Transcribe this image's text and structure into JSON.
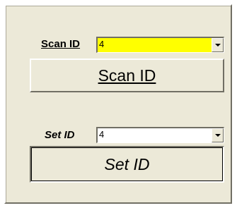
{
  "scan": {
    "label": "Scan ID",
    "value": "4",
    "button_label": "Scan ID",
    "field_color": "#ffff00"
  },
  "set": {
    "label": "Set ID",
    "value": "4",
    "button_label": "Set ID",
    "field_color": "#ffffff"
  },
  "icons": {
    "dropdown": "chevron-down-icon"
  }
}
